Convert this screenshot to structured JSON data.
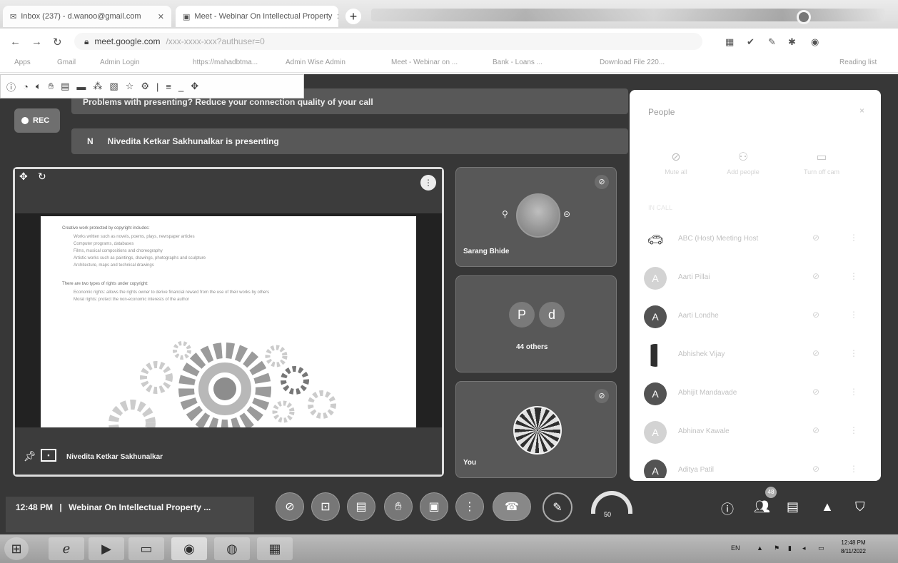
{
  "browser": {
    "tabs": [
      {
        "label": "Inbox (237) - d.wanoo@gmail.com",
        "icon": "gmail-icon"
      },
      {
        "label": "Meet - Webinar On Intellectual Property",
        "icon": "meet-icon"
      }
    ],
    "new_tab": "+",
    "url": "meet.google.com",
    "url_tail": "/xxx-xxxx-xxx?authuser=0",
    "bookmarks": [
      "Apps",
      "Gmail",
      "Admin Login",
      "https://mahadbtma...",
      "Admin Wise Admin",
      "Meet - Webinar on ...",
      "Bank - Loans ...",
      "Download File 220...",
      "Reading list"
    ]
  },
  "meet": {
    "rec_label": "REC",
    "top_banner": "Problems with presenting? Reduce your connection quality of your call",
    "presenting_initial": "N",
    "presenting_text": "Nivedita Ketkar Sakhunalkar is presenting",
    "presenter_label": "Nivedita Ketkar Sakhunalkar",
    "slide": {
      "bullets": [
        {
          "t": "Creative work protected by copyright includes:",
          "sub": false
        },
        {
          "t": "Works written such as novels, poems, plays, newspaper articles",
          "sub": true
        },
        {
          "t": "Computer programs, databases",
          "sub": true
        },
        {
          "t": "Films, musical compositions and choreography",
          "sub": true
        },
        {
          "t": "Artistic works such as paintings, drawings, photographs and sculpture",
          "sub": true
        },
        {
          "t": "Architecture, maps and technical drawings",
          "sub": true
        },
        {
          "t": "There are two types of rights under copyright:",
          "sub": false
        },
        {
          "t": "Economic rights: allows the rights owner to derive financial reward from the use of their works by others",
          "sub": true
        },
        {
          "t": "Moral rights: protect the non-economic interests of the author",
          "sub": true
        }
      ]
    },
    "tiles": {
      "t1_name": "Sarang Bhide",
      "t2_letters": [
        "P",
        "d"
      ],
      "t2_name": "44 others",
      "t3_name": "You"
    },
    "panel": {
      "title": "People",
      "close": "×",
      "actions": [
        "Mute all",
        "Add people",
        "Turn off cam"
      ],
      "in_call_label": "IN CALL",
      "people": [
        {
          "initial": "",
          "name": "ABC (Host) Meeting Host",
          "light": false,
          "car": true
        },
        {
          "initial": "A",
          "name": "Aarti Pillai",
          "light": true
        },
        {
          "initial": "A",
          "name": "Aarti Londhe",
          "light": false
        },
        {
          "initial": "",
          "name": "Abhishek Vijay",
          "light": false,
          "photo": true
        },
        {
          "initial": "A",
          "name": "Abhijit Mandavade",
          "light": false
        },
        {
          "initial": "A",
          "name": "Abhinav Kawale",
          "light": true
        },
        {
          "initial": "A",
          "name": "Aditya Patil",
          "light": false
        }
      ]
    },
    "bottom": {
      "time": "12:48 PM",
      "separator": "|",
      "meeting_title": "Webinar On Intellectual Property ...",
      "gauge_value": "50",
      "people_badge": "48"
    }
  },
  "taskbar": {
    "lang": "EN",
    "time": "12:48 PM",
    "date": "8/11/2022"
  }
}
